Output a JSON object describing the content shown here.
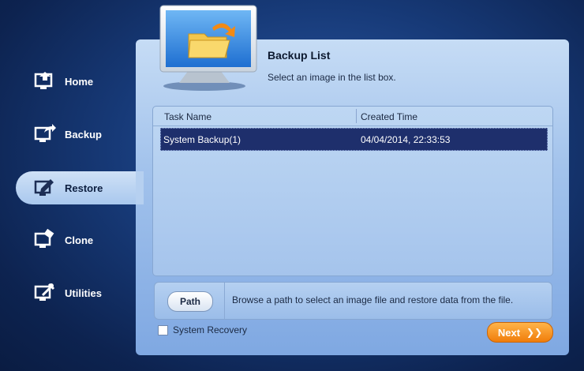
{
  "sidebar": {
    "items": [
      {
        "label": "Home",
        "icon": "home-icon"
      },
      {
        "label": "Backup",
        "icon": "backup-icon"
      },
      {
        "label": "Restore",
        "icon": "restore-icon",
        "active": true
      },
      {
        "label": "Clone",
        "icon": "clone-icon"
      },
      {
        "label": "Utilities",
        "icon": "utilities-icon"
      }
    ]
  },
  "main": {
    "title": "Backup List",
    "subtitle": "Select an image in the list box.",
    "table": {
      "columns": [
        "Task Name",
        "Created Time"
      ],
      "rows": [
        {
          "task": "System Backup(1)",
          "time": "04/04/2014, 22:33:53",
          "selected": true
        }
      ]
    },
    "path": {
      "button_label": "Path",
      "description": "Browse a path to select an image file and restore data from the file."
    },
    "system_recovery_label": "System Recovery",
    "system_recovery_checked": false,
    "next_label": "Next",
    "next_icon": "double-chevron-right-icon"
  },
  "colors": {
    "accent_orange": "#f28a16",
    "selected_row": "#1e2f6c",
    "panel_light": "#c6dcf5"
  }
}
